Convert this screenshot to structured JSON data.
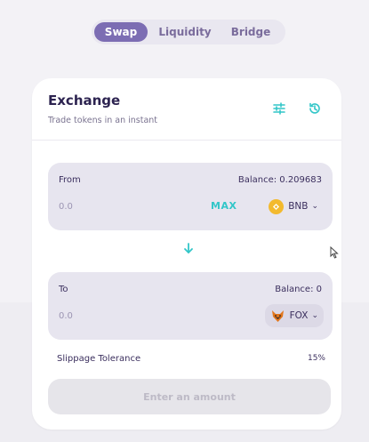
{
  "tabs": [
    {
      "label": "Swap",
      "active": true
    },
    {
      "label": "Liquidity",
      "active": false
    },
    {
      "label": "Bridge",
      "active": false
    }
  ],
  "exchange": {
    "title": "Exchange",
    "subtitle": "Trade tokens in an instant",
    "icons": [
      "settings-sliders-icon",
      "history-icon"
    ]
  },
  "from": {
    "label": "From",
    "balance": "Balance: 0.209683",
    "amount": "0.0",
    "max_label": "MAX",
    "token": "BNB"
  },
  "to": {
    "label": "To",
    "balance": "Balance: 0",
    "amount": "0.0",
    "token": "FOX"
  },
  "slippage": {
    "label": "Slippage Tolerance",
    "value": "15%"
  },
  "action_button": "Enter an amount",
  "colors": {
    "accent": "#7c6db3",
    "teal": "#32c6c8",
    "panel": "#e7e5ef"
  }
}
